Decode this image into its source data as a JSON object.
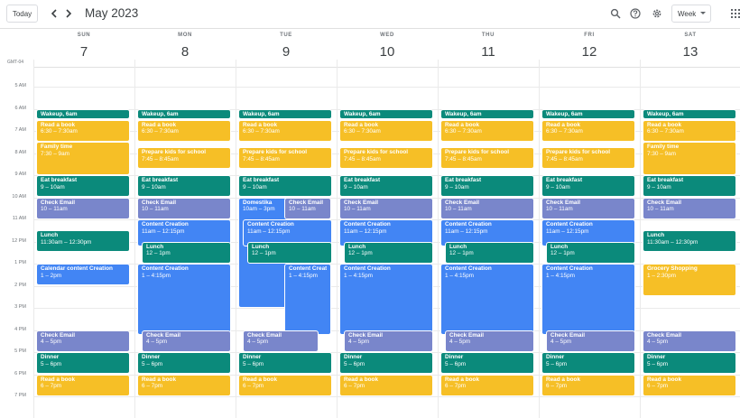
{
  "toolbar": {
    "today_label": "Today",
    "prev_icon": "chevron-left-icon",
    "next_icon": "chevron-right-icon",
    "period_title": "May 2023",
    "view_label": "Week",
    "icons": [
      "search-icon",
      "help-icon",
      "settings-icon",
      "apps-grid-icon"
    ]
  },
  "timezone_label": "GMT-04",
  "hours": [
    "5 AM",
    "6 AM",
    "7 AM",
    "8 AM",
    "9 AM",
    "10 AM",
    "11 AM",
    "12 PM",
    "1 PM",
    "2 PM",
    "3 PM",
    "4 PM",
    "5 PM",
    "6 PM",
    "7 PM"
  ],
  "colors": {
    "teal": "#0b8a7b",
    "yellow": "#f6bf26",
    "lavender": "#7986cb",
    "blue": "#4285f4"
  },
  "days": [
    {
      "name": "SUN",
      "num": "7",
      "events": [
        {
          "title": "Wakeup, 6am",
          "time": "",
          "color": "teal",
          "start": 6.0,
          "end": 6.5
        },
        {
          "title": "Read a book",
          "time": "6:30 – 7:30am",
          "color": "yellow",
          "start": 6.5,
          "end": 7.5
        },
        {
          "title": "Family time",
          "time": "7:30 – 9am",
          "color": "yellow",
          "start": 7.5,
          "end": 9.0
        },
        {
          "title": "Eat breakfast",
          "time": "9 – 10am",
          "color": "teal",
          "start": 9.0,
          "end": 10.0
        },
        {
          "title": "Check Email",
          "time": "10 – 11am",
          "color": "lavender",
          "start": 10.0,
          "end": 11.0
        },
        {
          "title": "Lunch",
          "time": "11:30am – 12:30pm",
          "color": "teal",
          "start": 11.5,
          "end": 12.5
        },
        {
          "title": "Calendar content Creation",
          "time": "1 – 2pm",
          "color": "blue",
          "start": 13.0,
          "end": 14.0
        },
        {
          "title": "Check Email",
          "time": "4 – 5pm",
          "color": "lavender",
          "start": 16.0,
          "end": 17.0
        },
        {
          "title": "Dinner",
          "time": "5 – 6pm",
          "color": "teal",
          "start": 17.0,
          "end": 18.0
        },
        {
          "title": "Read a book",
          "time": "6 – 7pm",
          "color": "yellow",
          "start": 18.0,
          "end": 19.0
        }
      ]
    },
    {
      "name": "MON",
      "num": "8",
      "events": [
        {
          "title": "Wakeup, 6am",
          "time": "",
          "color": "teal",
          "start": 6.0,
          "end": 6.5
        },
        {
          "title": "Read a book",
          "time": "6:30 – 7:30am",
          "color": "yellow",
          "start": 6.5,
          "end": 7.5
        },
        {
          "title": "Prepare kids for school",
          "time": "7:45 – 8:45am",
          "color": "yellow",
          "start": 7.75,
          "end": 8.75
        },
        {
          "title": "Eat breakfast",
          "time": "9 – 10am",
          "color": "teal",
          "start": 9.0,
          "end": 10.0
        },
        {
          "title": "Check Email",
          "time": "10 – 11am",
          "color": "lavender",
          "start": 10.0,
          "end": 11.0
        },
        {
          "title": "Content Creation",
          "time": "11am – 12:15pm",
          "color": "blue",
          "start": 11.0,
          "end": 12.25
        },
        {
          "title": "Lunch",
          "time": "12 – 1pm",
          "color": "teal",
          "start": 12.0,
          "end": 13.0,
          "indent": 1
        },
        {
          "title": "Content Creation",
          "time": "1 – 4:15pm",
          "color": "blue",
          "start": 13.0,
          "end": 16.25
        },
        {
          "title": "Check Email",
          "time": "4 – 5pm",
          "color": "lavender",
          "start": 16.0,
          "end": 17.0,
          "indent": 1
        },
        {
          "title": "Dinner",
          "time": "5 – 6pm",
          "color": "teal",
          "start": 17.0,
          "end": 18.0
        },
        {
          "title": "Read a book",
          "time": "6 – 7pm",
          "color": "yellow",
          "start": 18.0,
          "end": 19.0
        }
      ]
    },
    {
      "name": "TUE",
      "num": "9",
      "events": [
        {
          "title": "Wakeup, 6am",
          "time": "",
          "color": "teal",
          "start": 6.0,
          "end": 6.5
        },
        {
          "title": "Read a book",
          "time": "6:30 – 7:30am",
          "color": "yellow",
          "start": 6.5,
          "end": 7.5
        },
        {
          "title": "Prepare kids for school",
          "time": "7:45 – 8:45am",
          "color": "yellow",
          "start": 7.75,
          "end": 8.75
        },
        {
          "title": "Eat breakfast",
          "time": "9 – 10am",
          "color": "teal",
          "start": 9.0,
          "end": 10.0
        },
        {
          "title": "Domestika",
          "time": "10am – 3pm",
          "color": "blue",
          "start": 10.0,
          "end": 15.0,
          "half": "left"
        },
        {
          "title": "Check Email",
          "time": "10 – 11am",
          "color": "lavender",
          "start": 10.0,
          "end": 11.0,
          "half": "right"
        },
        {
          "title": "Content Creation",
          "time": "11am – 12:15pm",
          "color": "blue",
          "start": 11.0,
          "end": 12.25,
          "indent": 1
        },
        {
          "title": "Lunch",
          "time": "12 – 1pm",
          "color": "teal",
          "start": 12.0,
          "end": 13.0,
          "indent": 2
        },
        {
          "title": "Content Creation",
          "time": "1 – 4:15pm",
          "color": "blue",
          "start": 13.0,
          "end": 16.25,
          "half": "right"
        },
        {
          "title": "Check Email",
          "time": "4 – 5pm",
          "color": "lavender",
          "start": 16.0,
          "end": 17.0,
          "indent": 1,
          "narrow": true
        },
        {
          "title": "Dinner",
          "time": "5 – 6pm",
          "color": "teal",
          "start": 17.0,
          "end": 18.0
        },
        {
          "title": "Read a book",
          "time": "6 – 7pm",
          "color": "yellow",
          "start": 18.0,
          "end": 19.0
        }
      ]
    },
    {
      "name": "WED",
      "num": "10",
      "events": [
        {
          "title": "Wakeup, 6am",
          "time": "",
          "color": "teal",
          "start": 6.0,
          "end": 6.5
        },
        {
          "title": "Read a book",
          "time": "6:30 – 7:30am",
          "color": "yellow",
          "start": 6.5,
          "end": 7.5
        },
        {
          "title": "Prepare kids for school",
          "time": "7:45 – 8:45am",
          "color": "yellow",
          "start": 7.75,
          "end": 8.75
        },
        {
          "title": "Eat breakfast",
          "time": "9 – 10am",
          "color": "teal",
          "start": 9.0,
          "end": 10.0
        },
        {
          "title": "Check Email",
          "time": "10 – 11am",
          "color": "lavender",
          "start": 10.0,
          "end": 11.0
        },
        {
          "title": "Content Creation",
          "time": "11am – 12:15pm",
          "color": "blue",
          "start": 11.0,
          "end": 12.25
        },
        {
          "title": "Lunch",
          "time": "12 – 1pm",
          "color": "teal",
          "start": 12.0,
          "end": 13.0,
          "indent": 1
        },
        {
          "title": "Content Creation",
          "time": "1 – 4:15pm",
          "color": "blue",
          "start": 13.0,
          "end": 16.25
        },
        {
          "title": "Check Email",
          "time": "4 – 5pm",
          "color": "lavender",
          "start": 16.0,
          "end": 17.0,
          "indent": 1
        },
        {
          "title": "Dinner",
          "time": "5 – 6pm",
          "color": "teal",
          "start": 17.0,
          "end": 18.0
        },
        {
          "title": "Read a book",
          "time": "6 – 7pm",
          "color": "yellow",
          "start": 18.0,
          "end": 19.0
        }
      ]
    },
    {
      "name": "THU",
      "num": "11",
      "events": [
        {
          "title": "Wakeup, 6am",
          "time": "",
          "color": "teal",
          "start": 6.0,
          "end": 6.5
        },
        {
          "title": "Read a book",
          "time": "6:30 – 7:30am",
          "color": "yellow",
          "start": 6.5,
          "end": 7.5
        },
        {
          "title": "Prepare kids for school",
          "time": "7:45 – 8:45am",
          "color": "yellow",
          "start": 7.75,
          "end": 8.75
        },
        {
          "title": "Eat breakfast",
          "time": "9 – 10am",
          "color": "teal",
          "start": 9.0,
          "end": 10.0
        },
        {
          "title": "Check Email",
          "time": "10 – 11am",
          "color": "lavender",
          "start": 10.0,
          "end": 11.0
        },
        {
          "title": "Content Creation",
          "time": "11am – 12:15pm",
          "color": "blue",
          "start": 11.0,
          "end": 12.25
        },
        {
          "title": "Lunch",
          "time": "12 – 1pm",
          "color": "teal",
          "start": 12.0,
          "end": 13.0,
          "indent": 1
        },
        {
          "title": "Content Creation",
          "time": "1 – 4:15pm",
          "color": "blue",
          "start": 13.0,
          "end": 16.25
        },
        {
          "title": "Check Email",
          "time": "4 – 5pm",
          "color": "lavender",
          "start": 16.0,
          "end": 17.0,
          "indent": 1
        },
        {
          "title": "Dinner",
          "time": "5 – 6pm",
          "color": "teal",
          "start": 17.0,
          "end": 18.0
        },
        {
          "title": "Read a book",
          "time": "6 – 7pm",
          "color": "yellow",
          "start": 18.0,
          "end": 19.0
        }
      ]
    },
    {
      "name": "FRI",
      "num": "12",
      "events": [
        {
          "title": "Wakeup, 6am",
          "time": "",
          "color": "teal",
          "start": 6.0,
          "end": 6.5
        },
        {
          "title": "Read a book",
          "time": "6:30 – 7:30am",
          "color": "yellow",
          "start": 6.5,
          "end": 7.5
        },
        {
          "title": "Prepare kids for school",
          "time": "7:45 – 8:45am",
          "color": "yellow",
          "start": 7.75,
          "end": 8.75
        },
        {
          "title": "Eat breakfast",
          "time": "9 – 10am",
          "color": "teal",
          "start": 9.0,
          "end": 10.0
        },
        {
          "title": "Check Email",
          "time": "10 – 11am",
          "color": "lavender",
          "start": 10.0,
          "end": 11.0
        },
        {
          "title": "Content Creation",
          "time": "11am – 12:15pm",
          "color": "blue",
          "start": 11.0,
          "end": 12.25
        },
        {
          "title": "Lunch",
          "time": "12 – 1pm",
          "color": "teal",
          "start": 12.0,
          "end": 13.0,
          "indent": 1
        },
        {
          "title": "Content Creation",
          "time": "1 – 4:15pm",
          "color": "blue",
          "start": 13.0,
          "end": 16.25
        },
        {
          "title": "Check Email",
          "time": "4 – 5pm",
          "color": "lavender",
          "start": 16.0,
          "end": 17.0,
          "indent": 1
        },
        {
          "title": "Dinner",
          "time": "5 – 6pm",
          "color": "teal",
          "start": 17.0,
          "end": 18.0
        },
        {
          "title": "Read a book",
          "time": "6 – 7pm",
          "color": "yellow",
          "start": 18.0,
          "end": 19.0
        }
      ]
    },
    {
      "name": "SAT",
      "num": "13",
      "events": [
        {
          "title": "Wakeup, 6am",
          "time": "",
          "color": "teal",
          "start": 6.0,
          "end": 6.5
        },
        {
          "title": "Read a book",
          "time": "6:30 – 7:30am",
          "color": "yellow",
          "start": 6.5,
          "end": 7.5
        },
        {
          "title": "Family time",
          "time": "7:30 – 9am",
          "color": "yellow",
          "start": 7.5,
          "end": 9.0
        },
        {
          "title": "Eat breakfast",
          "time": "9 – 10am",
          "color": "teal",
          "start": 9.0,
          "end": 10.0
        },
        {
          "title": "Check Email",
          "time": "10 – 11am",
          "color": "lavender",
          "start": 10.0,
          "end": 11.0
        },
        {
          "title": "Lunch",
          "time": "11:30am – 12:30pm",
          "color": "teal",
          "start": 11.5,
          "end": 12.5
        },
        {
          "title": "Grocery Shopping",
          "time": "1 – 2:30pm",
          "color": "yellow",
          "start": 13.0,
          "end": 14.5
        },
        {
          "title": "Check Email",
          "time": "4 – 5pm",
          "color": "lavender",
          "start": 16.0,
          "end": 17.0
        },
        {
          "title": "Dinner",
          "time": "5 – 6pm",
          "color": "teal",
          "start": 17.0,
          "end": 18.0
        },
        {
          "title": "Read a book",
          "time": "6 – 7pm",
          "color": "yellow",
          "start": 18.0,
          "end": 19.0
        }
      ]
    }
  ]
}
